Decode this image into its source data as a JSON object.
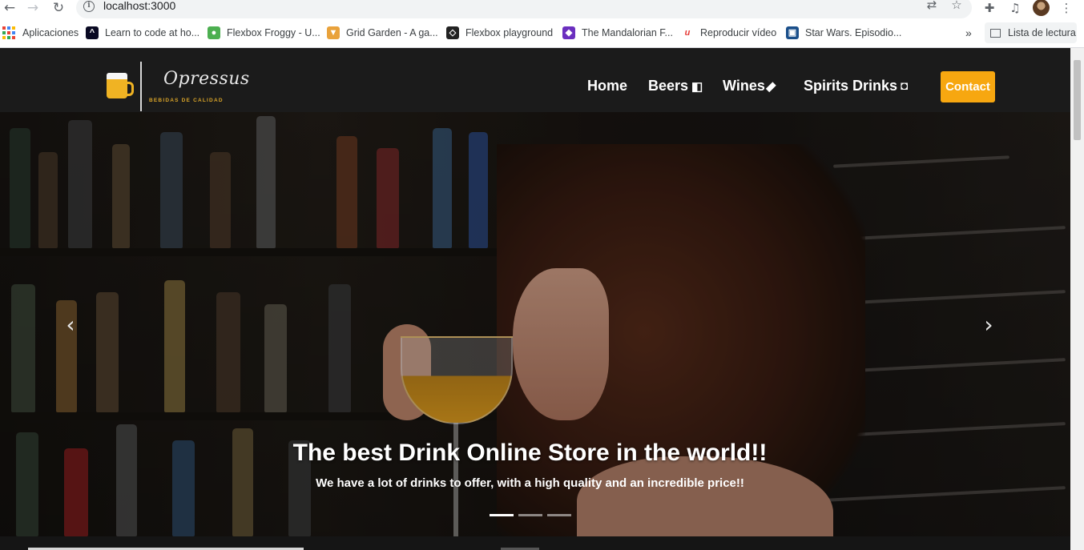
{
  "browser": {
    "url": "localhost:3000",
    "bookmarks": [
      {
        "label": "Aplicaciones",
        "icon": "apps-grid-icon"
      },
      {
        "label": "Learn to code at ho...",
        "icon": "freecodecamp-icon",
        "color": "#0a0a23"
      },
      {
        "label": "Flexbox Froggy - U...",
        "icon": "frog-icon",
        "color": "#4caf50"
      },
      {
        "label": "Grid Garden - A ga...",
        "icon": "carrot-icon",
        "color": "#e9a23b"
      },
      {
        "label": "Flexbox playground",
        "icon": "codepen-icon",
        "color": "#222222"
      },
      {
        "label": "The Mandalorian F...",
        "icon": "shield-icon",
        "color": "#6b2fbf"
      },
      {
        "label": "Reproducir vídeo",
        "icon": "play-u-icon",
        "color": "#e53935"
      },
      {
        "label": "Star Wars. Episodio...",
        "icon": "tv-icon",
        "color": "#1a4f8a"
      }
    ],
    "more_bookmarks": "»",
    "reading_list": "Lista de lectura"
  },
  "site": {
    "brand": "Opressus",
    "tagline": "BEBIDAS DE CALIDAD",
    "nav": [
      {
        "label": "Home",
        "icon": ""
      },
      {
        "label": "Beers",
        "icon": "beer-mug-icon"
      },
      {
        "label": "Wines",
        "icon": "wine-bottle-icon"
      },
      {
        "label": "Spirits Drinks",
        "icon": "glass-icon"
      }
    ],
    "contact": "Contact"
  },
  "hero": {
    "title": "The best Drink Online Store in the world!!",
    "subtitle": "We have a lot of drinks to offer, with a high quality and an incredible price!!",
    "slides": 3,
    "active_slide": 1,
    "prev_icon": "‹",
    "next_icon": "›"
  },
  "colors": {
    "accent": "#f7a710",
    "navbar": "#1b1b1b",
    "tagline": "#d9a429"
  }
}
